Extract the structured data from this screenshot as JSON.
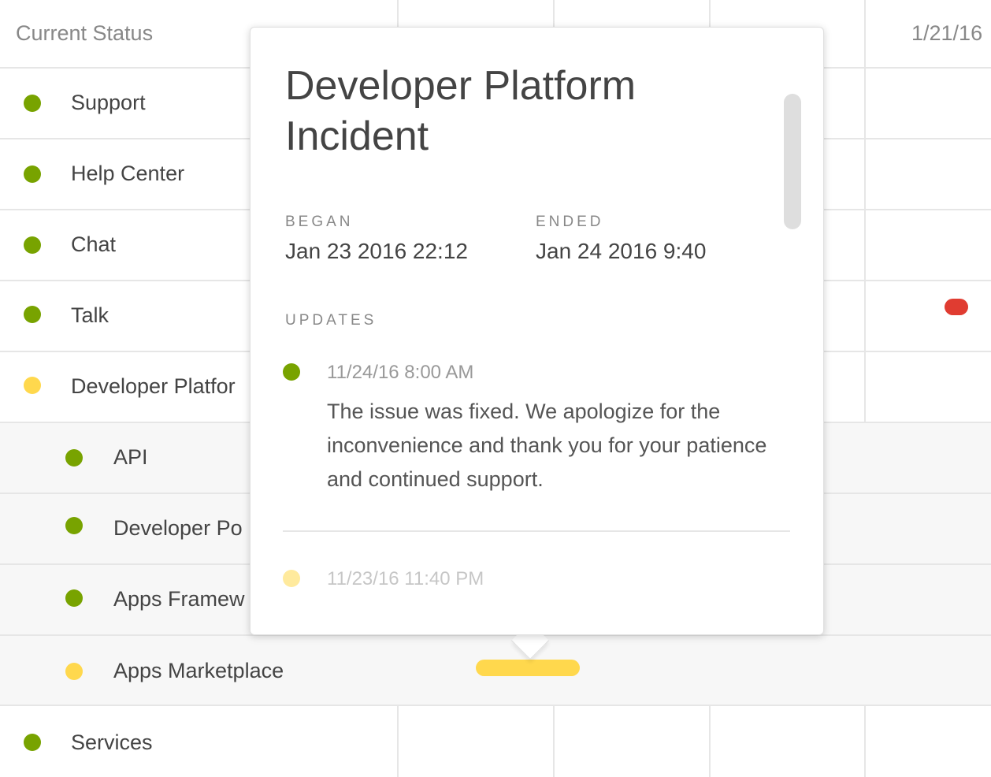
{
  "header": {
    "title": "Current Status",
    "dates": [
      "",
      "",
      "",
      "1/21/16"
    ]
  },
  "components": [
    {
      "label": "Support",
      "status": "green"
    },
    {
      "label": "Help Center",
      "status": "green"
    },
    {
      "label": "Chat",
      "status": "green"
    },
    {
      "label": "Talk",
      "status": "green"
    },
    {
      "label": "Developer Platfor",
      "status": "yellow"
    },
    {
      "label": "API",
      "status": "green",
      "sub": true
    },
    {
      "label": "Developer Po",
      "status": "green",
      "sub": true
    },
    {
      "label": "Apps Framew",
      "status": "green",
      "sub": true
    },
    {
      "label": "Apps Marketplace",
      "status": "yellow",
      "sub": true
    },
    {
      "label": "Services",
      "status": "green"
    }
  ],
  "popover": {
    "title": "Developer Platform Incident",
    "began_label": "BEGAN",
    "began_value": "Jan 23 2016 22:12",
    "ended_label": "ENDED",
    "ended_value": "Jan 24 2016 9:40",
    "updates_label": "UPDATES",
    "updates": [
      {
        "time": "11/24/16 8:00 AM",
        "status": "green",
        "text": "The issue was fixed. We apologize for the inconvenience and thank you for your patience and continued support."
      },
      {
        "time": "11/23/16 11:40 PM",
        "status": "yellow",
        "text": ""
      }
    ]
  },
  "colors": {
    "green": "#78a300",
    "yellow": "#ffd84d",
    "red": "#e03c31"
  }
}
